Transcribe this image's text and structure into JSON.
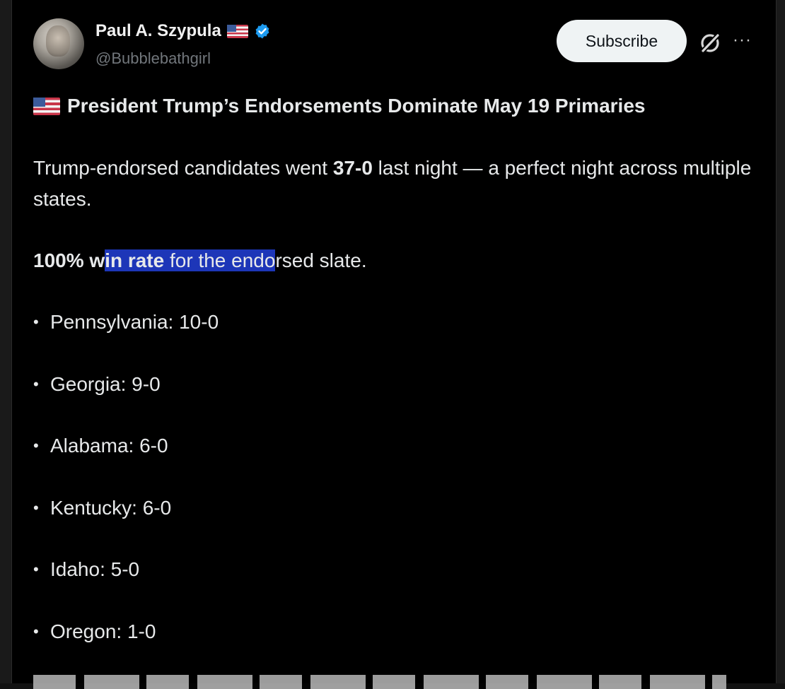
{
  "author": {
    "name": "Paul A. Szypula",
    "handle": "@Bubblebathgirl"
  },
  "actions": {
    "subscribe_label": "Subscribe",
    "grok_icon": "grok-icon",
    "more_icon": "more-icon",
    "more_glyph": "···"
  },
  "post": {
    "headline": "President Trump’s Endorsements Dominate May 19 Primaries",
    "para1_before": "Trump-endorsed candidates went ",
    "para1_bold": "37-0",
    "para1_after": " last night — a perfect night across multiple states.",
    "para2_bold_plain": "100% w",
    "para2_bold_highlight": "in rate",
    "para2_highlight": " for the endo",
    "para2_after": "rsed slate.",
    "states": [
      "Pennsylvania: 10-0",
      "Georgia: 9-0",
      "Alabama: 6-0",
      "Kentucky: 6-0",
      "Idaho: 5-0",
      "Oregon: 1-0"
    ]
  },
  "colors": {
    "background": "#000000",
    "highlight": "#1d36b8",
    "verified": "#1d9bf0"
  }
}
